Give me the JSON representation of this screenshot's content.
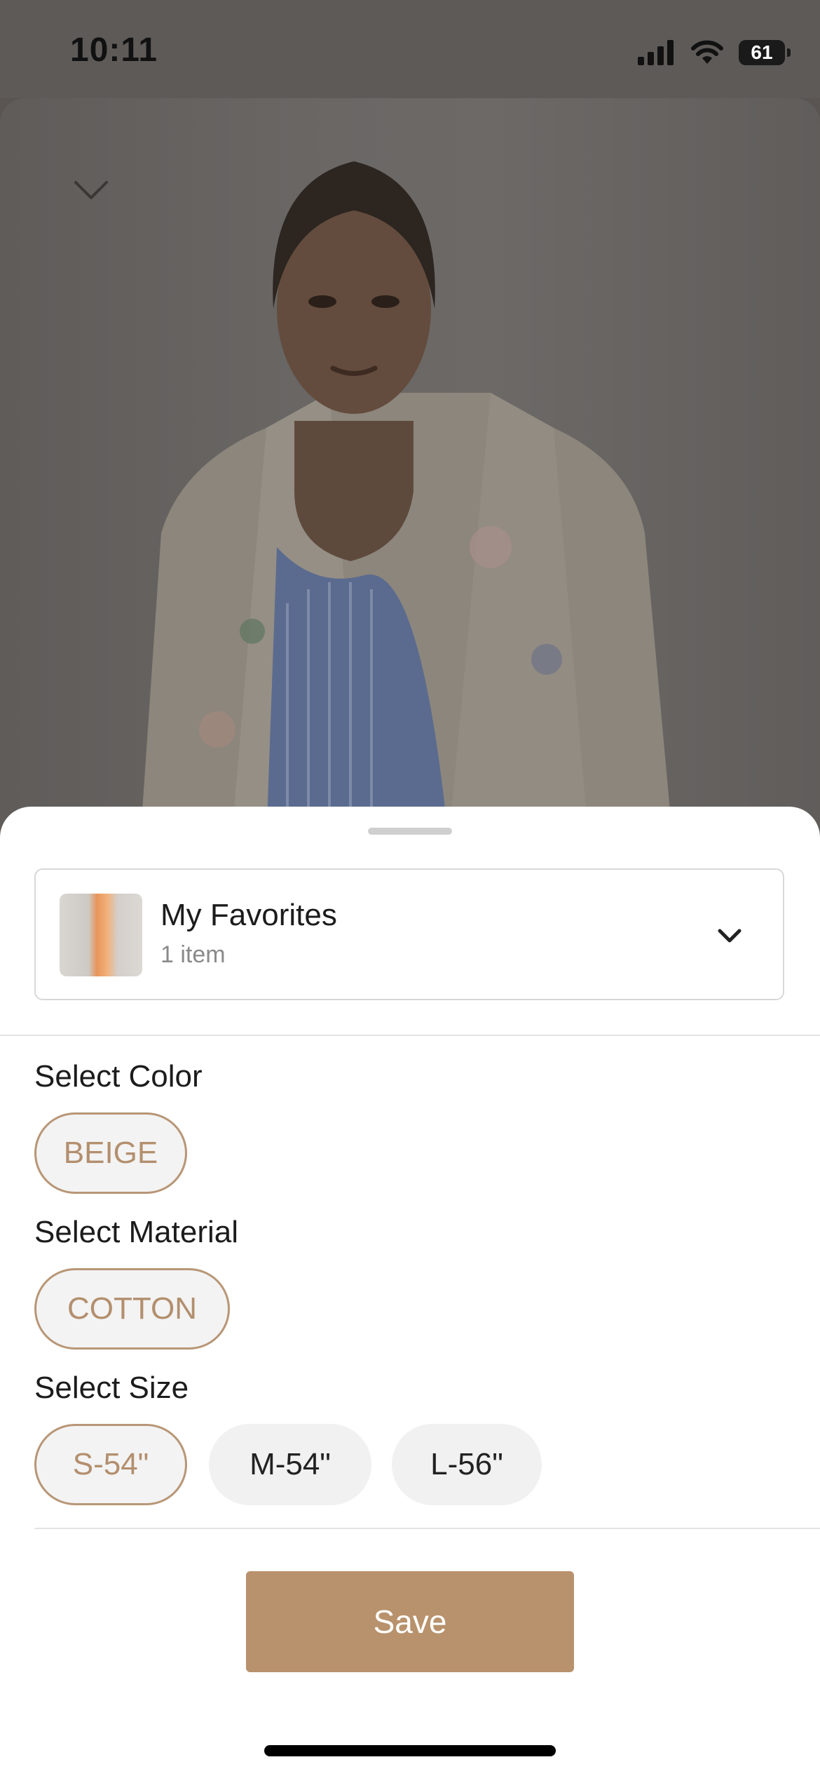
{
  "status_bar": {
    "time": "10:11",
    "battery": "61"
  },
  "colors": {
    "accent": "#b8926c",
    "selected_text": "#b38f6e",
    "chip_background": "#f1f1f1"
  },
  "icons": {
    "collapse": "chevron-down-icon",
    "dropdown": "chevron-down-icon",
    "signal": "cellular-signal-icon",
    "wifi": "wifi-icon",
    "battery": "battery-icon"
  },
  "collection": {
    "name": "My Favorites",
    "count": "1 item"
  },
  "color_section": {
    "label": "Select Color",
    "options": [
      {
        "label": "BEIGE",
        "selected": true
      }
    ]
  },
  "material_section": {
    "label": "Select Material",
    "options": [
      {
        "label": "COTTON",
        "selected": true
      }
    ]
  },
  "size_section": {
    "label": "Select Size",
    "options": [
      {
        "label": "S-54\"",
        "selected": true
      },
      {
        "label": "M-54\"",
        "selected": false
      },
      {
        "label": "L-56\"",
        "selected": false
      }
    ]
  },
  "actions": {
    "save_label": "Save"
  }
}
